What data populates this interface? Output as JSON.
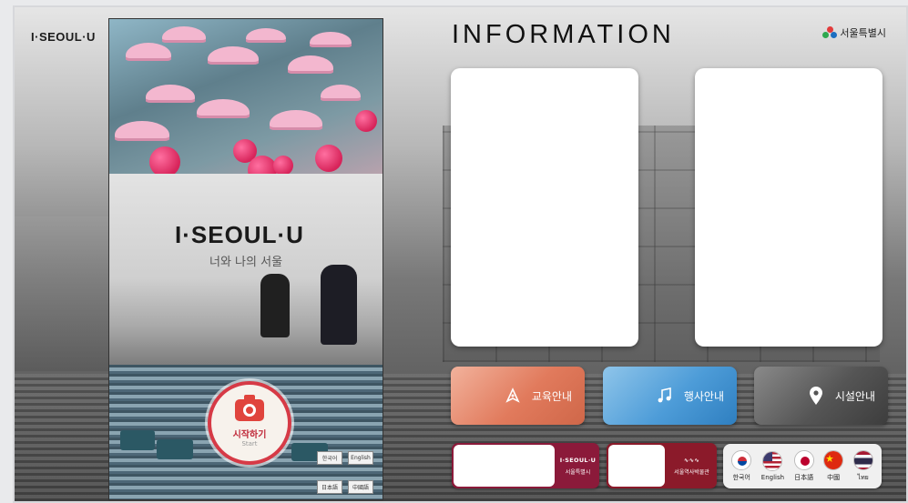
{
  "header": {
    "brand": "I·SEOUL·U",
    "title": "INFORMATION",
    "city_logo": "서울특별시"
  },
  "strip": {
    "photo_sign": "I·SEOUL·U",
    "photo_sub": "너와 나의 서울",
    "start_label": "시작하기",
    "start_sub": "Start",
    "mini_langs": [
      "한국어",
      "English",
      "日本語",
      "中國語"
    ]
  },
  "menu": [
    {
      "label": "교육안내",
      "icon": "pen-nib-icon",
      "color": "#e17a5c"
    },
    {
      "label": "행사안내",
      "icon": "music-note-icon",
      "color": "#4d9cd8"
    },
    {
      "label": "시설안내",
      "icon": "map-pin-icon",
      "color": "#555555"
    }
  ],
  "banners": [
    {
      "brand": "I·SEOUL·U",
      "name": "서울특별시"
    },
    {
      "brand": "∿∿∿",
      "name": "서울역사박물관"
    }
  ],
  "languages": [
    {
      "label": "한국어",
      "flag": "korea-flag-icon"
    },
    {
      "label": "English",
      "flag": "usa-flag-icon"
    },
    {
      "label": "日本語",
      "flag": "japan-flag-icon"
    },
    {
      "label": "中國",
      "flag": "china-flag-icon"
    },
    {
      "label": "ไทย",
      "flag": "thailand-flag-icon"
    }
  ],
  "colors": {
    "accent": "#d63a46",
    "banner": "#8b1a3a"
  }
}
